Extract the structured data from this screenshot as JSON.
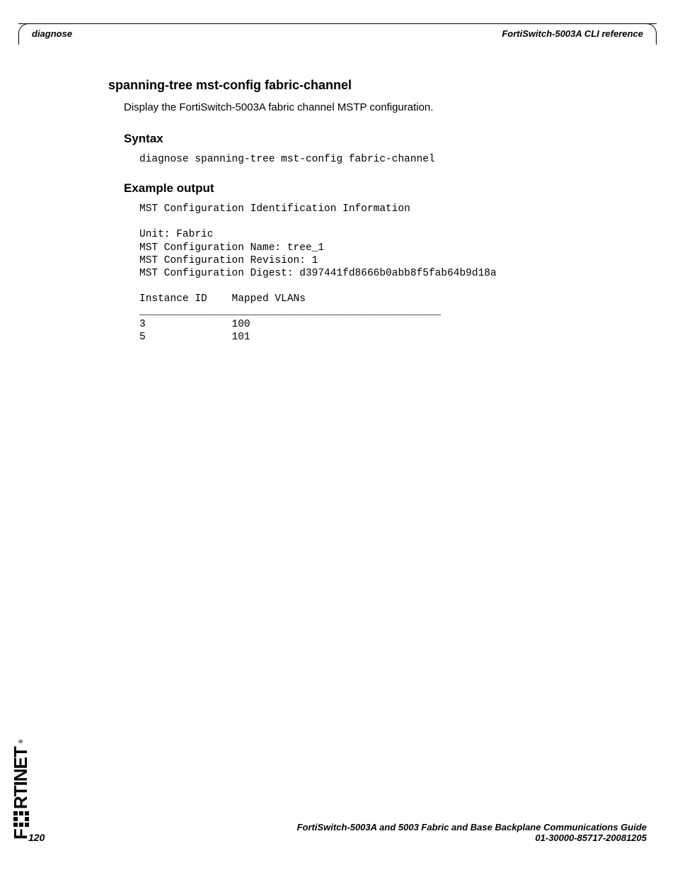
{
  "header": {
    "left": "diagnose",
    "right": "FortiSwitch-5003A CLI reference"
  },
  "section": {
    "title": "spanning-tree mst-config fabric-channel",
    "description": "Display the FortiSwitch-5003A fabric channel MSTP configuration."
  },
  "syntax": {
    "heading": "Syntax",
    "command": "diagnose spanning-tree mst-config fabric-channel"
  },
  "example": {
    "heading": "Example output",
    "output": "MST Configuration Identification Information\n\nUnit: Fabric\nMST Configuration Name: tree_1\nMST Configuration Revision: 1\nMST Configuration Digest: d397441fd8666b0abb8f5fab64b9d18a\n\nInstance ID    Mapped VLANs\n_________________________________________________\n3              100\n5              101"
  },
  "logo_text": "RTINET",
  "footer": {
    "line1": "FortiSwitch-5003A and 5003   Fabric and Base Backplane Communications Guide",
    "line2": "01-30000-85717-20081205",
    "page_number": "120"
  }
}
